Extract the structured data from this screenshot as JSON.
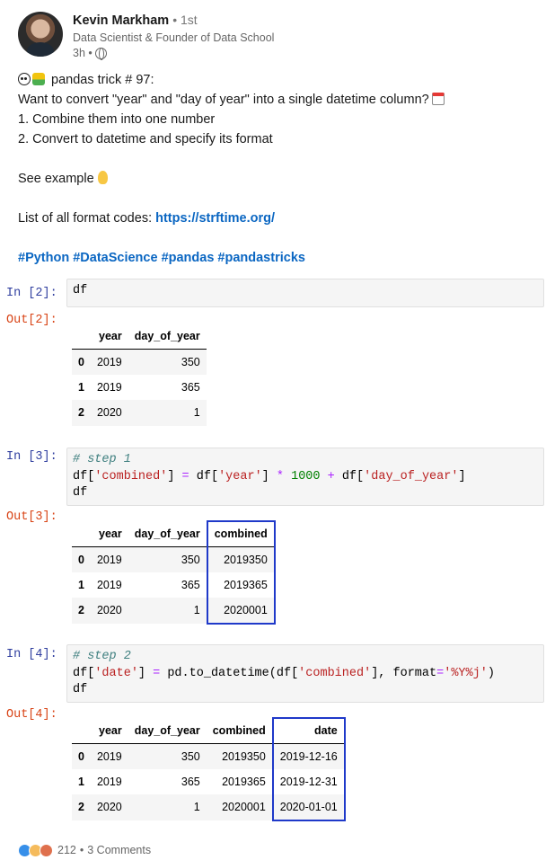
{
  "author": {
    "name": "Kevin Markham",
    "degree": "• 1st",
    "title": "Data Scientist & Founder of Data School",
    "time": "3h •"
  },
  "post": {
    "line1": "pandas trick # 97:",
    "line2": "Want to convert \"year\" and \"day of year\" into a single datetime column?",
    "line3": "1. Combine them into one number",
    "line4": "2. Convert to datetime and specify its format",
    "line5": "See example",
    "line6_prefix": "List of all format codes: ",
    "link": "https://strftime.org/",
    "hashtags": "#Python #DataScience #pandas #pandastricks"
  },
  "cells": {
    "in2": "In [2]:",
    "out2": "Out[2]:",
    "in3": "In [3]:",
    "out3": "Out[3]:",
    "in4": "In [4]:",
    "out4": "Out[4]:",
    "code2": "df",
    "code3_comment": "# step 1",
    "code4_comment": "# step 2",
    "df_var": "df"
  },
  "tables": {
    "headers": [
      "year",
      "day_of_year",
      "combined",
      "date"
    ],
    "index": [
      "0",
      "1",
      "2"
    ],
    "year": [
      "2019",
      "2019",
      "2020"
    ],
    "day_of_year": [
      "350",
      "365",
      "1"
    ],
    "combined": [
      "2019350",
      "2019365",
      "2020001"
    ],
    "date": [
      "2019-12-16",
      "2019-12-31",
      "2020-01-01"
    ]
  },
  "reactions": {
    "count": "212",
    "comments": "3 Comments",
    "sep": "•"
  },
  "colors": {
    "highlight": "#1f39c9",
    "link": "#0a66c2",
    "prompt_in": "#303f9f",
    "prompt_out": "#d84315"
  }
}
